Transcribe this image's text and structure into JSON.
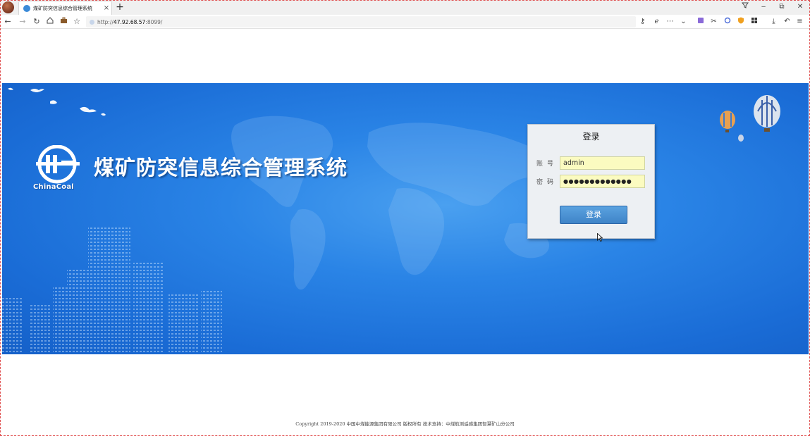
{
  "browser": {
    "tab_title": "煤矿防突信息综合管理系统",
    "tab_close": "×",
    "new_tab": "+",
    "url_scheme": "http://",
    "url_host": "47.92.68.57",
    "url_rest": ":8099/",
    "window_buttons": [
      "‒",
      "⧉",
      "✕"
    ]
  },
  "banner": {
    "logo_text": "ChinaCoal",
    "system_title": "煤矿防突信息综合管理系统"
  },
  "login": {
    "title": "登录",
    "account_label": "账号",
    "account_value": "admin",
    "password_label": "密码",
    "password_value": "●●●●●●●●●●●●●",
    "submit_label": "登录"
  },
  "footer": {
    "copyright": "Copyright 2019-2020 中国中煤能源集团有限公司 版权所有 技术支持：中煤航测遥感集团智慧矿山分公司"
  },
  "colors": {
    "banner_blue": "#2a84e6",
    "button_blue": "#4a90d2",
    "input_yellow": "#fbfbc0"
  }
}
